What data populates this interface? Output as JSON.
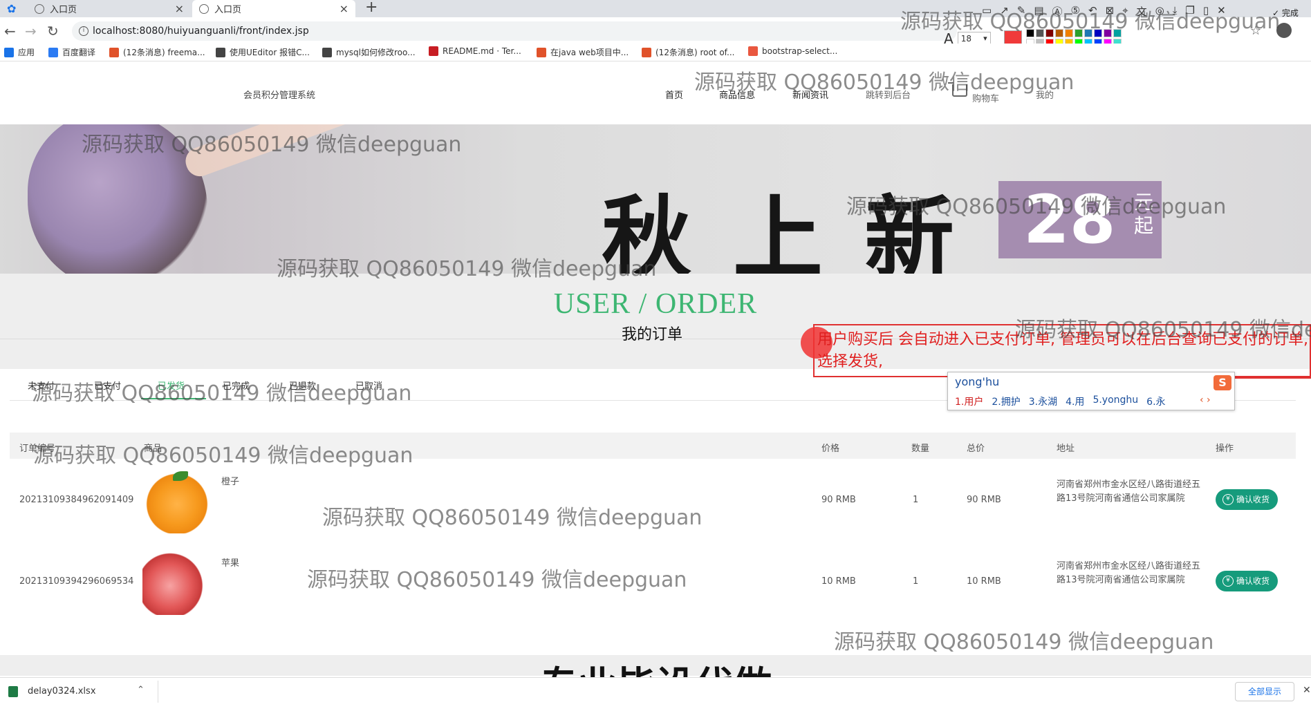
{
  "browser": {
    "tabs": [
      {
        "label": "入口页"
      },
      {
        "label": "入口页"
      }
    ],
    "url": "localhost:8080/huiyuanguanli/front/index.jsp",
    "bookmarks": [
      {
        "label": "应用",
        "icon": "apps-grid-icon",
        "color": "#1a73e8"
      },
      {
        "label": "百度翻译",
        "icon": "translate-icon",
        "color": "#2b7bf3"
      },
      {
        "label": "(12条消息) freema...",
        "icon": "csdn-icon",
        "color": "#e0522a"
      },
      {
        "label": "使用UEditor 报错C...",
        "icon": "bookmark-icon",
        "color": "#444"
      },
      {
        "label": "mysql如何修改roo...",
        "icon": "bookmark-icon",
        "color": "#444"
      },
      {
        "label": "README.md · Ter...",
        "icon": "gitee-icon",
        "color": "#c71d23"
      },
      {
        "label": "在java web项目中...",
        "icon": "csdn-icon",
        "color": "#e0522a"
      },
      {
        "label": "(12条消息) root of...",
        "icon": "csdn-icon",
        "color": "#e0522a"
      },
      {
        "label": "bootstrap-select...",
        "icon": "jianshu-icon",
        "color": "#e9573f"
      }
    ],
    "annotation_toolbar": {
      "done_label": "完成",
      "font_size": "18",
      "current_color": "#f03a3a",
      "palette": [
        "#000000",
        "#555555",
        "#7f0000",
        "#b55a00",
        "#f08000",
        "#2ca02c",
        "#1f77b4",
        "#0000c0",
        "#8000a0",
        "#00a0a0",
        "#ffffff",
        "#c0c0c0",
        "#ff0000",
        "#ffff00",
        "#ffc000",
        "#00ff00",
        "#00c0ff",
        "#0040ff",
        "#ff00ff",
        "#40e0d0"
      ]
    }
  },
  "site": {
    "title": "会员积分管理系统",
    "nav": [
      {
        "label": "首页",
        "muted": false
      },
      {
        "label": "商品信息",
        "muted": false
      },
      {
        "label": "新闻资讯",
        "muted": false
      },
      {
        "label": "跳转到后台",
        "muted": true
      },
      {
        "label": "购物车",
        "muted": true
      },
      {
        "label": "我的",
        "muted": true
      }
    ],
    "banner": {
      "headline": "秋上新",
      "price": "28",
      "price_unit": "元起"
    },
    "section": {
      "title_en": "USER / ORDER",
      "title_cn": "我的订单"
    },
    "accent": "#3db672"
  },
  "order_tabs": [
    {
      "label": "未支付"
    },
    {
      "label": "已支付"
    },
    {
      "label": "已发货",
      "active": true
    },
    {
      "label": "已完成"
    },
    {
      "label": "已退款"
    },
    {
      "label": "已取消"
    }
  ],
  "table": {
    "headers": [
      "订单编号",
      "商品",
      "价格",
      "数量",
      "总价",
      "地址",
      "操作"
    ],
    "rows": [
      {
        "order_no": "20213109384962091409",
        "product": "橙子",
        "price": "90 RMB",
        "qty": "1",
        "total": "90 RMB",
        "address": "河南省郑州市金水区经八路街道经五路13号院河南省通信公司家属院",
        "action": "确认收货",
        "image": "orange"
      },
      {
        "order_no": "20213109394296069534",
        "product": "苹果",
        "price": "10 RMB",
        "qty": "1",
        "total": "10 RMB",
        "address": "河南省郑州市金水区经八路街道经五路13号院河南省通信公司家属院",
        "action": "确认收货",
        "image": "apple"
      }
    ]
  },
  "annotation": {
    "text": "用户购买后  会自动进入已支付订单, 管理员可以在后台查询已支付的订单, 选择发货,",
    "color": "#e02020"
  },
  "ime": {
    "input": "yong'hu",
    "candidates": [
      "1.用户",
      "2.拥护",
      "3.永湖",
      "4.用",
      "5.yonghu",
      "6.永"
    ],
    "nav": "‹ ›",
    "logo": "S"
  },
  "watermark": "源码获取 QQ86050149 微信deepguan",
  "caption": "专业毕设代做",
  "downloads": {
    "file": "delay0324.xlsx",
    "show_all": "全部显示"
  }
}
